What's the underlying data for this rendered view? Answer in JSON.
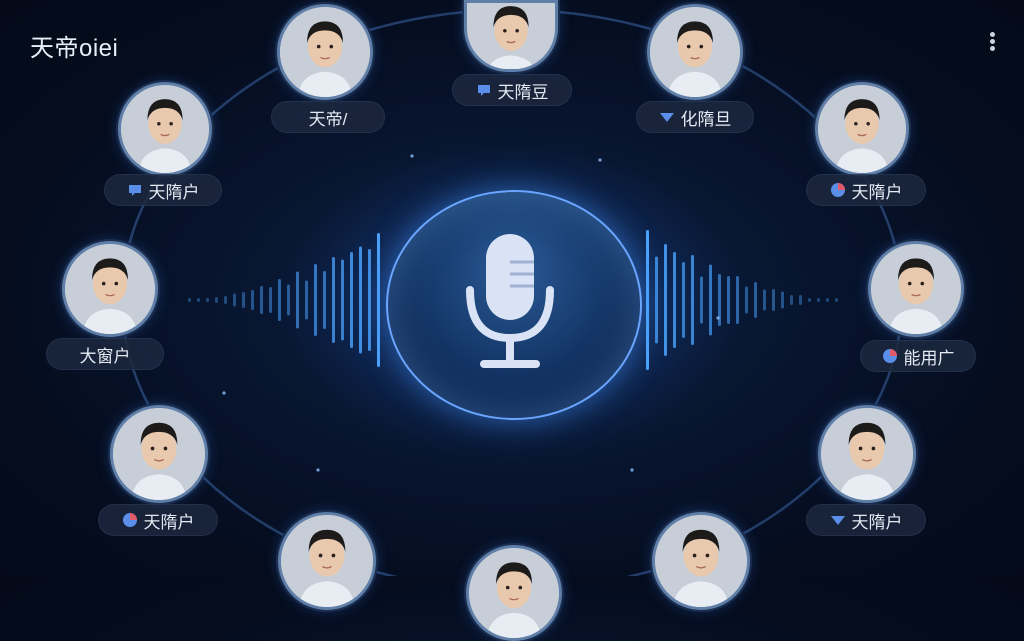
{
  "app": {
    "title": "天帝oiei"
  },
  "users": [
    {
      "id": "u1",
      "label": "天帝/",
      "icon": "none"
    },
    {
      "id": "u2",
      "label": "天隋豆",
      "icon": "speech-bubble-icon"
    },
    {
      "id": "u3",
      "label": "化隋旦",
      "icon": "triangle-down-icon"
    },
    {
      "id": "u4",
      "label": "天隋户",
      "icon": "speech-bubble-icon"
    },
    {
      "id": "u5",
      "label": "天隋户",
      "icon": "person-badge-icon"
    },
    {
      "id": "u6",
      "label": "大窗户",
      "icon": "none"
    },
    {
      "id": "u7",
      "label": "能用广",
      "icon": "person-badge-icon"
    },
    {
      "id": "u8",
      "label": "天隋户",
      "icon": "person-badge-icon"
    },
    {
      "id": "u9",
      "label": "天隋户",
      "icon": "triangle-down-icon"
    }
  ],
  "colors": {
    "accent": "#4aa3ff",
    "ring": "#2a4a7a",
    "tag_bg": "#1c283e",
    "badge_blue": "#5b8ee8",
    "badge_red": "#e05a6a"
  }
}
